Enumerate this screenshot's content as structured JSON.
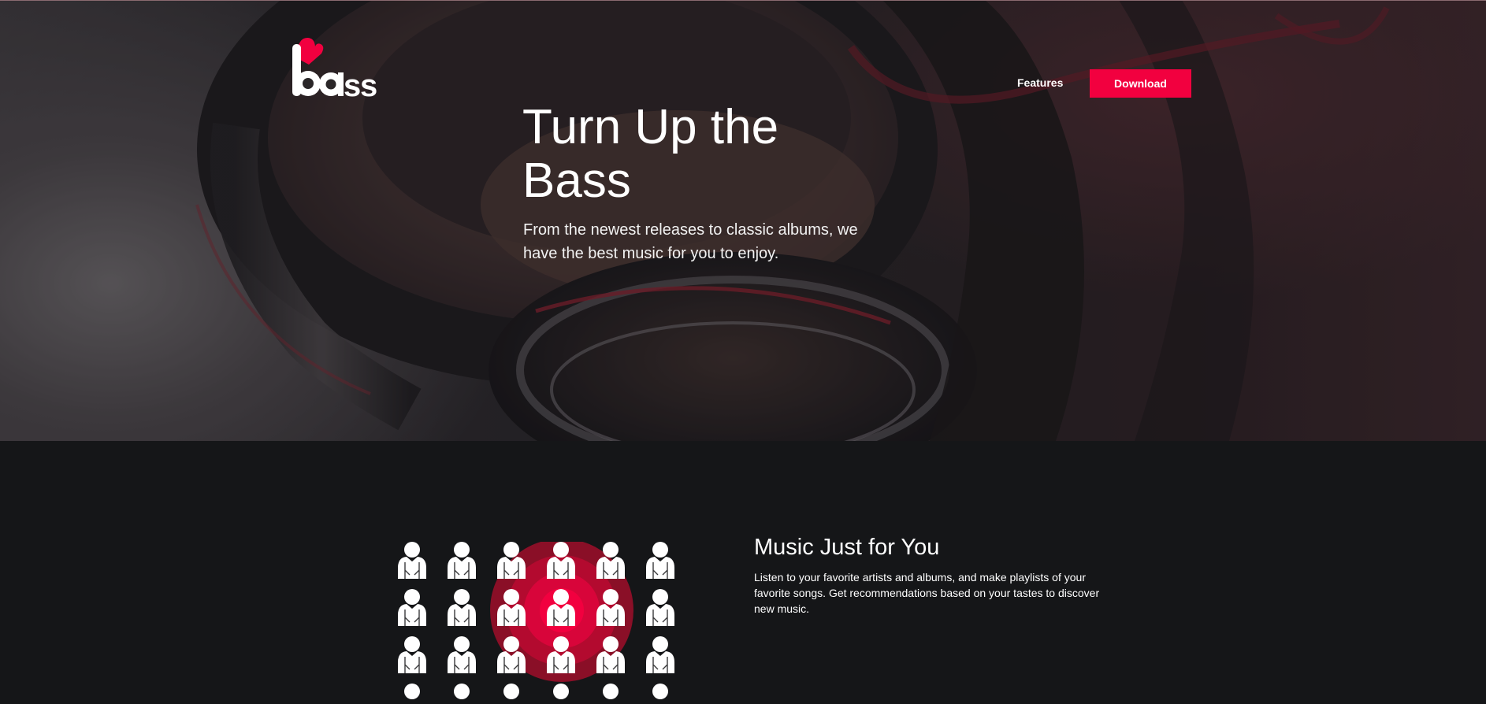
{
  "brand": {
    "logo_text": "bass",
    "accent_color": "#f2003f"
  },
  "nav": {
    "features_label": "Features",
    "download_label": "Download"
  },
  "hero": {
    "title": "Turn Up the Bass",
    "subtitle": "From the newest releases to classic albums, we have the best music for you to enjoy.",
    "background_icon": "headphones-photo"
  },
  "feature": {
    "title": "Music Just for You",
    "text": "Listen to your favorite artists and albums, and make playlists of your favorite songs. Get recommendations based on your tastes to discover new music.",
    "graphic_icon": "people-target-icon"
  }
}
